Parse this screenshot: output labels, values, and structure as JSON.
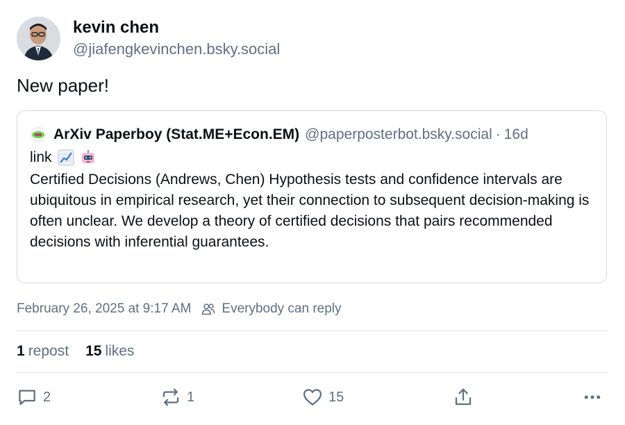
{
  "author": {
    "display_name": "kevin chen",
    "handle": "@jiafengkevinchen.bsky.social"
  },
  "post": {
    "text": "New paper!",
    "timestamp": "February 26, 2025 at 9:17 AM",
    "reply_setting": "Everybody can reply"
  },
  "quoted_post": {
    "display_name": "ArXiv Paperboy (Stat.ME+Econ.EM)",
    "handle": "@paperposterbot.bsky.social",
    "separator": "·",
    "age": "16d",
    "link_text": "link",
    "emojis": [
      "chart-increasing-emoji",
      "robot-emoji"
    ],
    "body": "Certified Decisions (Andrews, Chen) Hypothesis tests and confidence intervals are ubiquitous in empirical research, yet their connection to subsequent decision-making is often unclear. We develop a theory of certified decisions that pairs recommended decisions with inferential guarantees."
  },
  "stats": {
    "reposts_count": "1",
    "reposts_label": "repost",
    "likes_count": "15",
    "likes_label": "likes"
  },
  "actions": {
    "reply_count": "2",
    "repost_count": "1",
    "like_count": "15"
  },
  "icons": {
    "reply": "speech-bubble-icon",
    "repost": "repost-arrows-icon",
    "like": "heart-icon",
    "share": "share-upload-icon",
    "more": "ellipsis-icon",
    "audience": "people-icon"
  },
  "colors": {
    "text_primary": "#0b0f14",
    "text_secondary": "#5f6f82",
    "border": "#d4dbe2"
  }
}
